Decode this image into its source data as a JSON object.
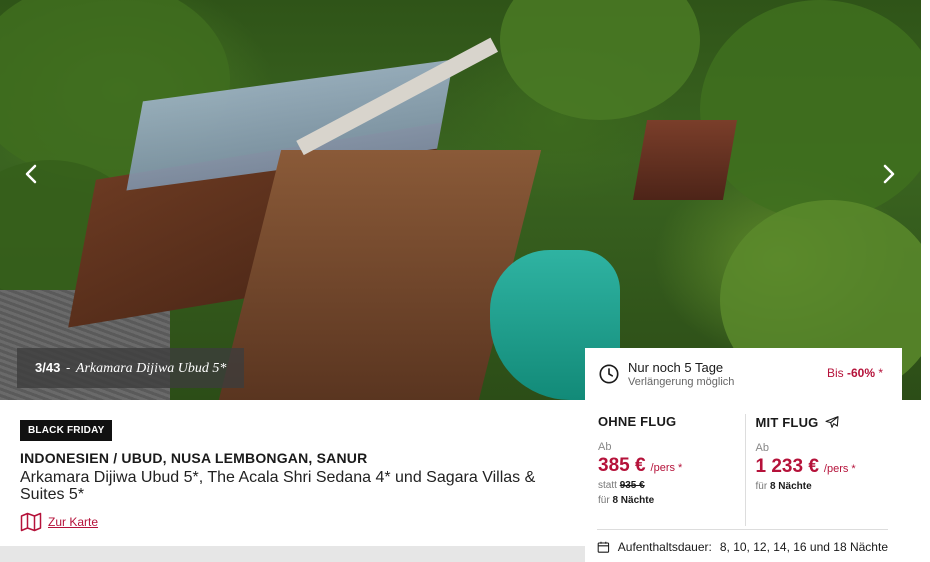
{
  "gallery": {
    "counter": "3/43",
    "separator": "-",
    "caption": "Arkamara Dijiwa Ubud 5*",
    "prev_icon": "chevron-left-icon",
    "next_icon": "chevron-right-icon"
  },
  "deal": {
    "remaining": "Nur noch 5 Tage",
    "extension": "Verlängerung möglich",
    "discount_prefix": "Bis",
    "discount_value": "-60%",
    "discount_suffix": "*"
  },
  "offers": {
    "without_flight": {
      "title": "OHNE FLUG",
      "from": "Ab",
      "price": "385 €",
      "per": "/pers *",
      "old_prefix": "statt",
      "old_price": "935 €",
      "nights_prefix": "für",
      "nights": "8 Nächte"
    },
    "with_flight": {
      "title": "MIT FLUG",
      "from": "Ab",
      "price": "1 233 €",
      "per": "/pers *",
      "nights_prefix": "für",
      "nights": "8 Nächte"
    }
  },
  "stay": {
    "label": "Aufenthaltsdauer:",
    "values": "8, 10, 12, 14, 16 und 18 Nächte"
  },
  "listing": {
    "badge": "BLACK FRIDAY",
    "region": "INDONESIEN / UBUD, NUSA LEMBONGAN, SANUR",
    "hotels": "Arkamara Dijiwa Ubud 5*, The Acala Shri Sedana 4* und Sagara Villas & Suites 5*",
    "map_link": "Zur Karte"
  },
  "colors": {
    "accent": "#b5123a",
    "badge_bg": "#111111"
  }
}
